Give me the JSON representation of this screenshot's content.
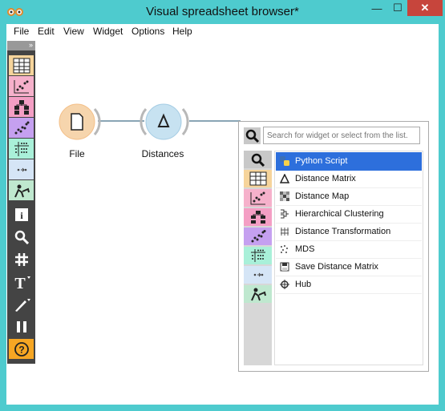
{
  "window": {
    "title": "Visual spreadsheet browser*"
  },
  "title_controls": {
    "minimize": "—",
    "maximize": "☐",
    "close": "✕"
  },
  "menu": [
    "File",
    "Edit",
    "View",
    "Widget",
    "Options",
    "Help"
  ],
  "toolbox": {
    "expand_label": "»",
    "categories": [
      {
        "name": "data",
        "color": "#f6d49b"
      },
      {
        "name": "visualize",
        "color": "#f6b1cb"
      },
      {
        "name": "model",
        "color": "#f49ec4"
      },
      {
        "name": "evaluate",
        "color": "#c5a0f0"
      },
      {
        "name": "unsupervised",
        "color": "#a9f0d9"
      },
      {
        "name": "transform",
        "color": "#d5e5f6"
      },
      {
        "name": "prototypes",
        "color": "#bfe8cf"
      }
    ],
    "tools": [
      "info",
      "search",
      "grid",
      "text",
      "pen",
      "pause",
      "help"
    ]
  },
  "workflow": {
    "nodes": [
      {
        "label": "File",
        "icon": "document-icon",
        "color": "#f6d5ad"
      },
      {
        "label": "Distances",
        "icon": "delta-icon",
        "color": "#c7e2f1"
      }
    ]
  },
  "popup": {
    "search_placeholder": "Search for widget or select from the list.",
    "items": [
      {
        "label": "Python Script",
        "icon": "python-icon",
        "selected": true
      },
      {
        "label": "Distance Matrix",
        "icon": "delta-icon",
        "selected": false
      },
      {
        "label": "Distance Map",
        "icon": "distance-map-icon",
        "selected": false
      },
      {
        "label": "Hierarchical Clustering",
        "icon": "dendrogram-icon",
        "selected": false
      },
      {
        "label": "Distance Transformation",
        "icon": "transformation-icon",
        "selected": false
      },
      {
        "label": "MDS",
        "icon": "mds-icon",
        "selected": false
      },
      {
        "label": "Save Distance Matrix",
        "icon": "save-icon",
        "selected": false
      },
      {
        "label": "Hub",
        "icon": "hub-icon",
        "selected": false
      }
    ]
  }
}
